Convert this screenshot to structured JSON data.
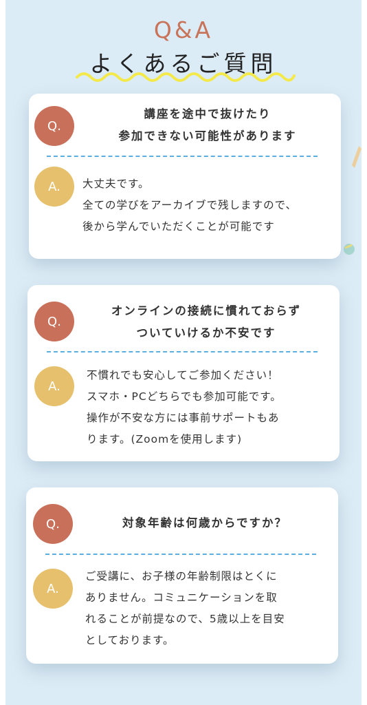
{
  "header": {
    "qa_label": "Q&A",
    "title": "よくあるご質問"
  },
  "faq": [
    {
      "q_badge": "Q.",
      "question_lines": [
        "講座を途中で抜けたり",
        "参加できない可能性があります"
      ],
      "a_badge": "A.",
      "answer_lines": [
        "大丈夫です。",
        "全ての学びをアーカイブで残しますので、",
        "後から学んでいただくことが可能です"
      ]
    },
    {
      "q_badge": "Q.",
      "question_lines": [
        "オンラインの接続に慣れておらず",
        "ついていけるか不安です"
      ],
      "a_badge": "A.",
      "answer_lines": [
        "不慣れでも安心してご参加ください！",
        "スマホ・PCどちらでも参加可能です。",
        "操作が不安な方には事前サポートもあ",
        "ります。(Zoomを使用します)"
      ]
    },
    {
      "q_badge": "Q.",
      "question_lines": [
        "対象年齢は何歳からですか？"
      ],
      "a_badge": "A.",
      "answer_lines": [
        "ご受講に、お子様の年齢制限はとくに",
        "ありません。コミュニケーションを取",
        "れることが前提なので、5歳以上を目安",
        "としております。"
      ]
    }
  ],
  "colors": {
    "background": "#dcecf6",
    "accent_q": "#c8705a",
    "accent_a": "#e6c06c",
    "divider": "#5aaee0",
    "squiggle": "#f4e94a"
  }
}
